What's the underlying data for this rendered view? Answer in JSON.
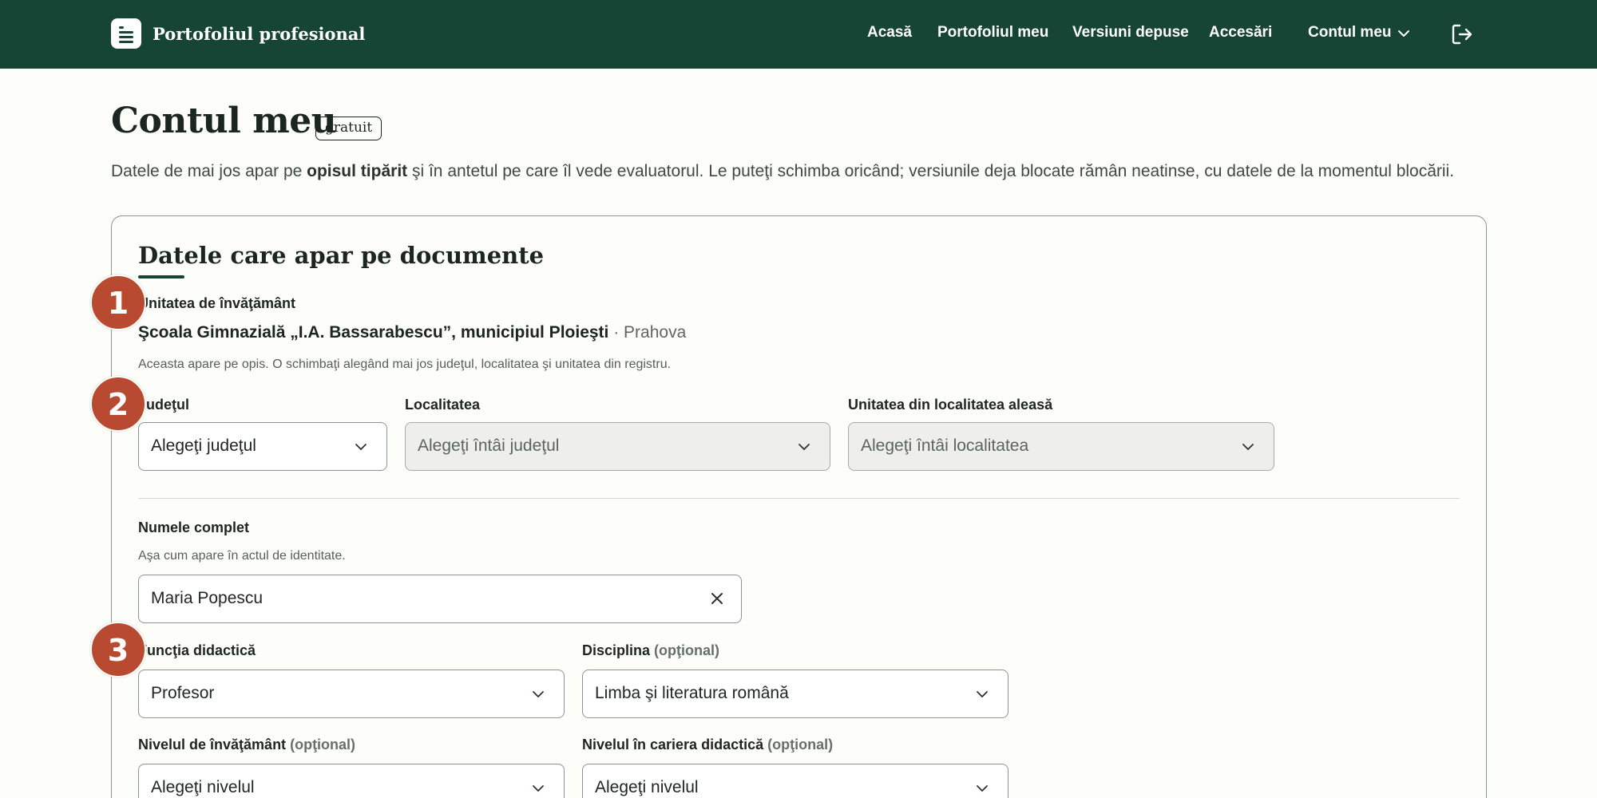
{
  "header": {
    "brand": "Portofoliul profesional",
    "nav": [
      "Acasă",
      "Portofoliul meu",
      "Versiuni depuse",
      "Accesări"
    ],
    "account": "Contul meu",
    "logout_icon": "logout-icon",
    "colors": {
      "bar": "#174535",
      "accent": "#b84a31"
    }
  },
  "page": {
    "title": "Contul meu",
    "plan_badge": "gratuit",
    "intro_before": "Datele de mai jos apar pe ",
    "intro_bold": "opisul tipărit",
    "intro_after": " şi în antetul pe care îl vede evaluatorul. Le puteţi schimba oricând; versiunile deja blocate rămân neatinse, cu datele de la momentul blocării."
  },
  "card": {
    "title": "Datele care apar pe documente",
    "school_label": "Unitatea de învăţământ",
    "school_name": "Şcoala Gimnazială „I.A. Bassarabescu”, municipiul Ploieşti",
    "school_separator": " · ",
    "school_county": "Prahova",
    "school_hint": "Aceasta apare pe opis. O schimbaţi alegând mai jos judeţul, localitatea şi unitatea din registru.",
    "county_label": "Judeţul",
    "county_value": "Alegeţi judeţul",
    "locality_label": "Localitatea",
    "locality_value": "Alegeţi întâi judeţul",
    "unit_label": "Unitatea din localitatea aleasă",
    "unit_value": "Alegeţi întâi localitatea",
    "name_label": "Numele complet",
    "name_hint": "Aşa cum apare în actul de identitate.",
    "name_value": "Maria Popescu",
    "function_label": "Funcţia didactică",
    "function_value": "Profesor",
    "discipline_label": "Disciplina",
    "optional": "(opţional)",
    "discipline_value": "Limba şi literatura română",
    "level_label": "Nivelul de învăţământ",
    "level_value": "Alegeţi nivelul",
    "career_label": "Nivelul în cariera didactică",
    "career_value": "Alegeţi nivelul"
  },
  "steps": [
    "1",
    "2",
    "3"
  ]
}
